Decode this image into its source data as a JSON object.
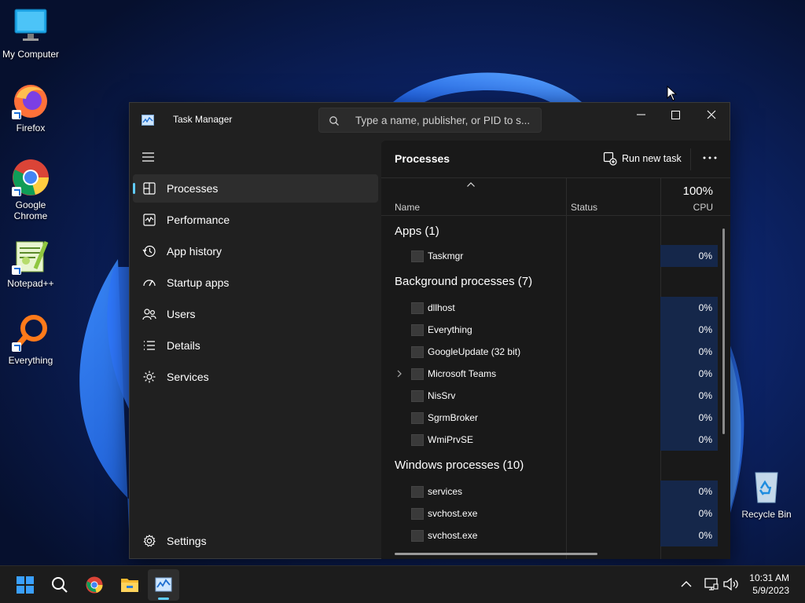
{
  "desktop": {
    "icons": [
      {
        "label": "My Computer"
      },
      {
        "label": "Firefox"
      },
      {
        "label": "Google Chrome"
      },
      {
        "label": "Notepad++"
      },
      {
        "label": "Everything"
      },
      {
        "label": "Recycle Bin"
      }
    ]
  },
  "window": {
    "title": "Task Manager",
    "search_placeholder": "Type a name, publisher, or PID to s...",
    "controls": {
      "minimize": "minimize-icon",
      "maximize": "maximize-icon",
      "close": "close-icon"
    }
  },
  "nav": {
    "items": [
      {
        "label": "Processes",
        "icon": "processes-icon",
        "active": true
      },
      {
        "label": "Performance",
        "icon": "performance-icon"
      },
      {
        "label": "App history",
        "icon": "app-history-icon"
      },
      {
        "label": "Startup apps",
        "icon": "startup-icon"
      },
      {
        "label": "Users",
        "icon": "users-icon"
      },
      {
        "label": "Details",
        "icon": "details-icon"
      },
      {
        "label": "Services",
        "icon": "services-icon"
      }
    ],
    "settings_label": "Settings"
  },
  "processes": {
    "title": "Processes",
    "run_new_task": "Run new task",
    "columns": {
      "name": "Name",
      "status": "Status",
      "cpu_total": "100%",
      "cpu": "CPU"
    },
    "groups": [
      {
        "label": "Apps (1)",
        "rows": [
          {
            "name": "Taskmgr",
            "cpu": "0%"
          }
        ]
      },
      {
        "label": "Background processes (7)",
        "rows": [
          {
            "name": "dllhost",
            "cpu": "0%"
          },
          {
            "name": "Everything",
            "cpu": "0%"
          },
          {
            "name": "GoogleUpdate (32 bit)",
            "cpu": "0%"
          },
          {
            "name": "Microsoft Teams",
            "cpu": "0%",
            "expandable": true
          },
          {
            "name": "NisSrv",
            "cpu": "0%"
          },
          {
            "name": "SgrmBroker",
            "cpu": "0%"
          },
          {
            "name": "WmiPrvSE",
            "cpu": "0%"
          }
        ]
      },
      {
        "label": "Windows processes (10)",
        "rows": [
          {
            "name": "services",
            "cpu": "0%"
          },
          {
            "name": "svchost.exe",
            "cpu": "0%"
          },
          {
            "name": "svchost.exe",
            "cpu": "0%"
          }
        ]
      }
    ]
  },
  "taskbar": {
    "apps": [
      "start-icon",
      "search-icon",
      "chrome-icon",
      "file-explorer-icon",
      "task-manager-icon"
    ],
    "time": "10:31 AM",
    "date": "5/9/2023"
  },
  "colors": {
    "accent": "#60cdff",
    "cpu_cell": "#15274a",
    "window_bg": "#202020"
  }
}
